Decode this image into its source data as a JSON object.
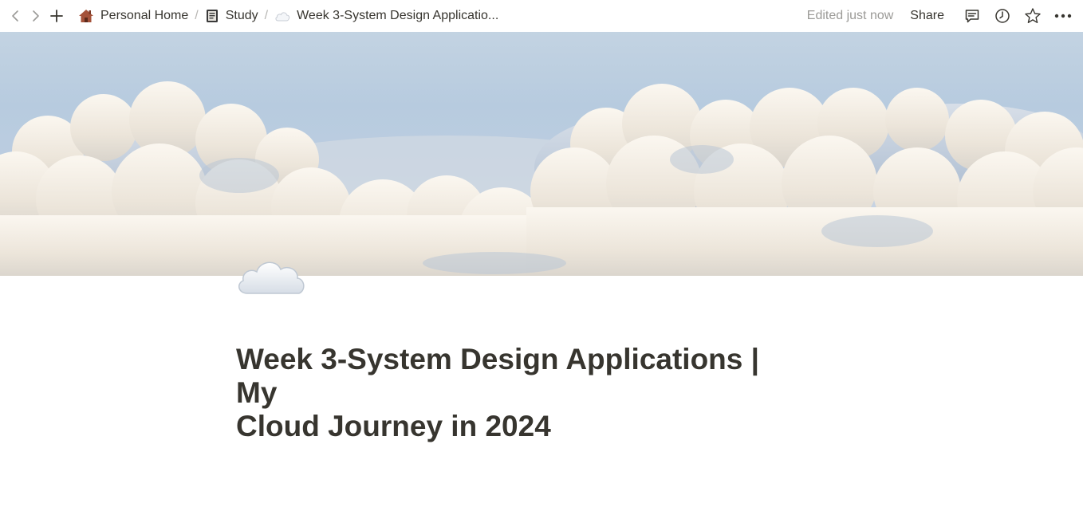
{
  "topbar": {
    "back_icon": "chevron-left-icon",
    "forward_icon": "chevron-right-icon",
    "add_icon": "plus-icon",
    "breadcrumbs": [
      {
        "icon": "house-icon",
        "label": "Personal Home"
      },
      {
        "icon": "notebook-icon",
        "label": "Study"
      },
      {
        "icon": "cloud-icon",
        "label": "Week 3-System Design Applicatio..."
      }
    ],
    "separator": "/",
    "edited_status": "Edited just now",
    "share_label": "Share",
    "actions": [
      "comment-icon",
      "clock-icon",
      "star-icon",
      "more-icon"
    ]
  },
  "cover": {
    "description_icon": "clouds-cover-image"
  },
  "page": {
    "icon": "cloud-icon",
    "title_line1": "Week 3-System Design Applications | My",
    "title_line2": "Cloud Journey in 2024"
  },
  "colors": {
    "text": "#37352f",
    "muted": "#9b9a97",
    "sky": "#b7cbdf",
    "cloud": "#f3eee6"
  }
}
